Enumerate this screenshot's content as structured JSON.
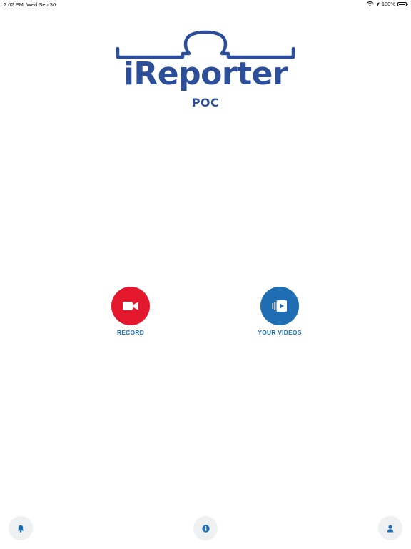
{
  "status_bar": {
    "time": "2:02 PM",
    "date": "Wed Sep 30",
    "battery_percent": "100%",
    "battery_level": 1.0,
    "icons": [
      "wifi-icon",
      "location-arrow-icon",
      "battery-icon"
    ]
  },
  "logo": {
    "title": "iReporter",
    "subtitle": "POC",
    "color": "#2d4f9a"
  },
  "actions": {
    "record": {
      "label": "RECORD",
      "icon": "video-camera-icon",
      "color": "#e3182d"
    },
    "videos": {
      "label": "YOUR VIDEOS",
      "icon": "video-library-icon",
      "color": "#1f6eb3"
    }
  },
  "toolbar": {
    "left_icon": "bell-icon",
    "center_icon": "info-icon",
    "right_icon": "user-icon",
    "icon_color": "#1f6eb3"
  }
}
